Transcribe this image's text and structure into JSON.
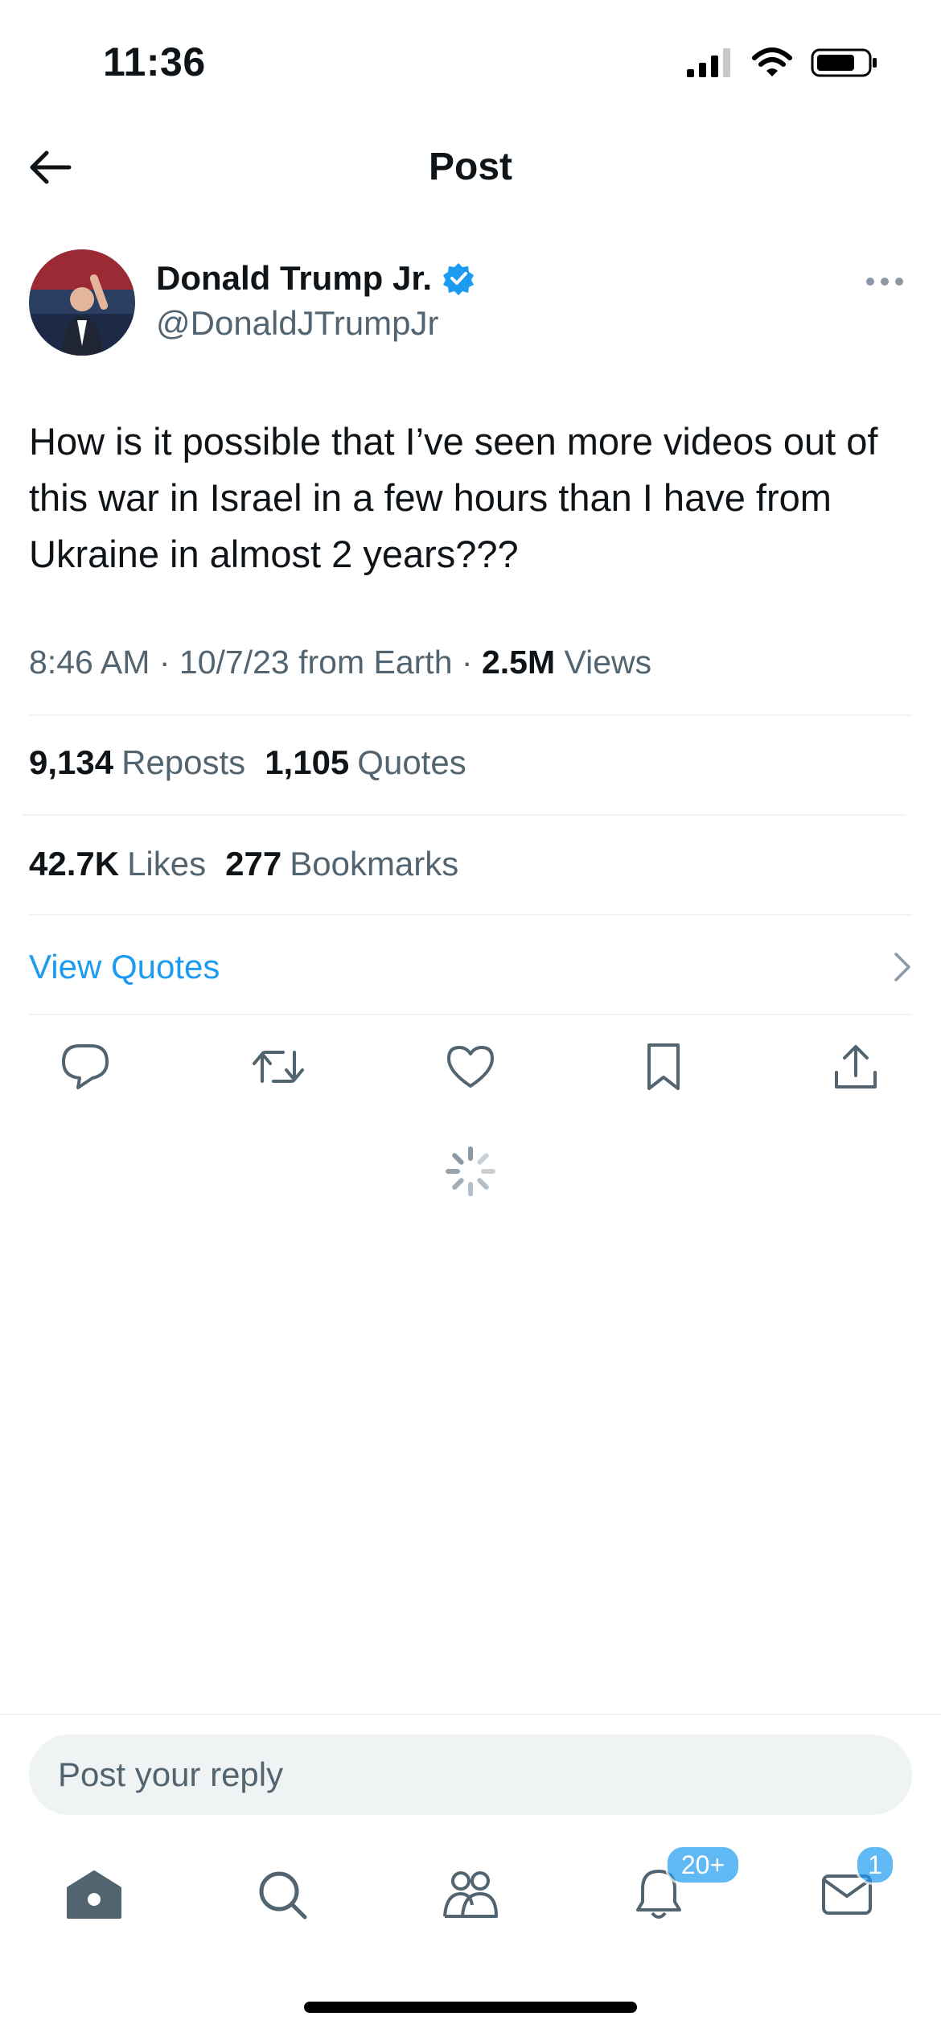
{
  "status_bar": {
    "time": "11:36"
  },
  "header": {
    "title": "Post"
  },
  "author": {
    "name": "Donald Trump Jr.",
    "handle": "@DonaldJTrumpJr"
  },
  "post": {
    "text": "How is it possible that I’ve seen more videos out of this war in Israel in a few hours than I have from Ukraine in almost 2 years???",
    "time": "8:46 AM",
    "date": "10/7/23",
    "source": "from Earth",
    "views_count": "2.5M",
    "views_label": "Views",
    "separator": "·"
  },
  "stats": {
    "reposts_count": "9,134",
    "reposts_label": "Reposts",
    "quotes_count": "1,105",
    "quotes_label": "Quotes",
    "likes_count": "42.7K",
    "likes_label": "Likes",
    "bookmarks_count": "277",
    "bookmarks_label": "Bookmarks"
  },
  "view_quotes": {
    "label": "View Quotes"
  },
  "reply": {
    "placeholder": "Post your reply"
  },
  "tabbar": {
    "notifications_badge": "20+",
    "messages_badge": "1"
  },
  "colors": {
    "accent": "#1d9bf0",
    "text_primary": "#0f1419",
    "text_secondary": "#536471",
    "divider": "#eff3f4"
  },
  "icons": [
    "back-arrow-icon",
    "verified-badge-icon",
    "more-icon",
    "reply-icon",
    "repost-icon",
    "like-icon",
    "bookmark-icon",
    "share-icon",
    "chevron-right-icon",
    "loading-spinner-icon",
    "home-icon",
    "search-icon",
    "communities-icon",
    "notifications-icon",
    "messages-icon"
  ]
}
